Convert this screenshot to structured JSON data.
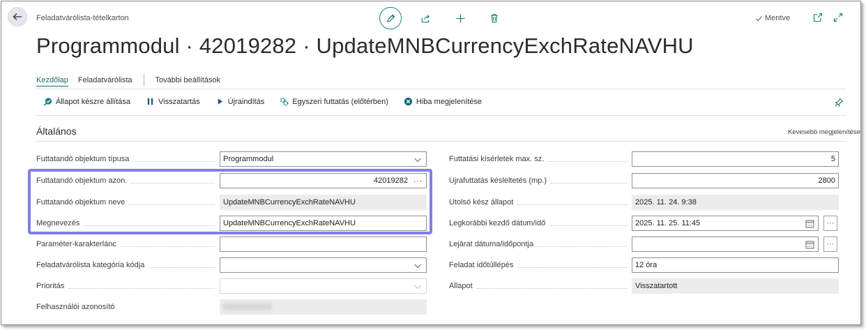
{
  "header": {
    "caption": "Feladatvárólista-tételkarton",
    "saved_label": "Mentve",
    "title": "Programmodul · 42019282 · UpdateMNBCurrencyExchRateNAVHU"
  },
  "icons": {
    "back": "arrow-left-icon",
    "edit": "pencil-icon",
    "share": "share-icon",
    "new": "plus-icon",
    "delete": "trash-icon",
    "saved": "checkmark-icon",
    "open_new_window": "open-new-window-icon",
    "expand": "expand-icon",
    "pin": "pin-icon"
  },
  "tabs": [
    {
      "label": "Kezdőlap",
      "active": true
    },
    {
      "label": "Feladatvárólista",
      "active": false
    },
    {
      "label": "További beállítások",
      "active": false
    }
  ],
  "toolbar": [
    {
      "label": "Állapot készre állítása",
      "icon": "ready-status-icon"
    },
    {
      "label": "Visszatartás",
      "icon": "pause-icon"
    },
    {
      "label": "Újraindítás",
      "icon": "play-icon"
    },
    {
      "label": "Egyszeri futtatás (előtérben)",
      "icon": "run-once-icon"
    },
    {
      "label": "Hiba megjelenítése",
      "icon": "error-icon"
    }
  ],
  "section": {
    "title": "Általános",
    "toggle_label": "Kevesebb megjelenítése"
  },
  "left_fields": [
    {
      "label": "Futtatandó objektum típusa",
      "value": "Programmodul",
      "kind": "select"
    },
    {
      "label": "Futtatandó objektum azon.",
      "value": "42019282",
      "kind": "lookup"
    },
    {
      "label": "Futtatandó objektum neve",
      "value": "UpdateMNBCurrencyExchRateNAVHU",
      "kind": "readonly"
    },
    {
      "label": "Megnevezés",
      "value": "UpdateMNBCurrencyExchRateNAVHU",
      "kind": "text"
    },
    {
      "label": "Paraméter-karakterlánc",
      "value": "",
      "kind": "text"
    },
    {
      "label": "Feladatvárólista kategória kódja",
      "value": "",
      "kind": "select"
    },
    {
      "label": "Prioritás",
      "value": "",
      "kind": "select-disabled"
    },
    {
      "label": "Felhasználói azonosító",
      "value": "",
      "kind": "readonly-blurred"
    }
  ],
  "right_fields": [
    {
      "label": "Futtatási kísérletek max. sz.",
      "value": "5",
      "kind": "number"
    },
    {
      "label": "Újrafuttatás késleltetés (mp.)",
      "value": "2800",
      "kind": "number"
    },
    {
      "label": "Utolsó kész állapot",
      "value": "2025. 11. 24. 9:38",
      "kind": "readonly"
    },
    {
      "label": "Legkorábbi kezdő dátum/idő",
      "value": "2025. 11. 25. 11:45",
      "kind": "datetime"
    },
    {
      "label": "Lejárat dátuma/időpontja",
      "value": "",
      "kind": "datetime"
    },
    {
      "label": "Feladat időtúllépés",
      "value": "12 óra",
      "kind": "text"
    },
    {
      "label": "Állapot",
      "value": "Visszatartott",
      "kind": "readonly"
    }
  ],
  "ellipsis": "···",
  "colors": {
    "accent": "#1a8080",
    "highlight_border": "#7f7fe4",
    "readonly_bg": "#ececec"
  }
}
